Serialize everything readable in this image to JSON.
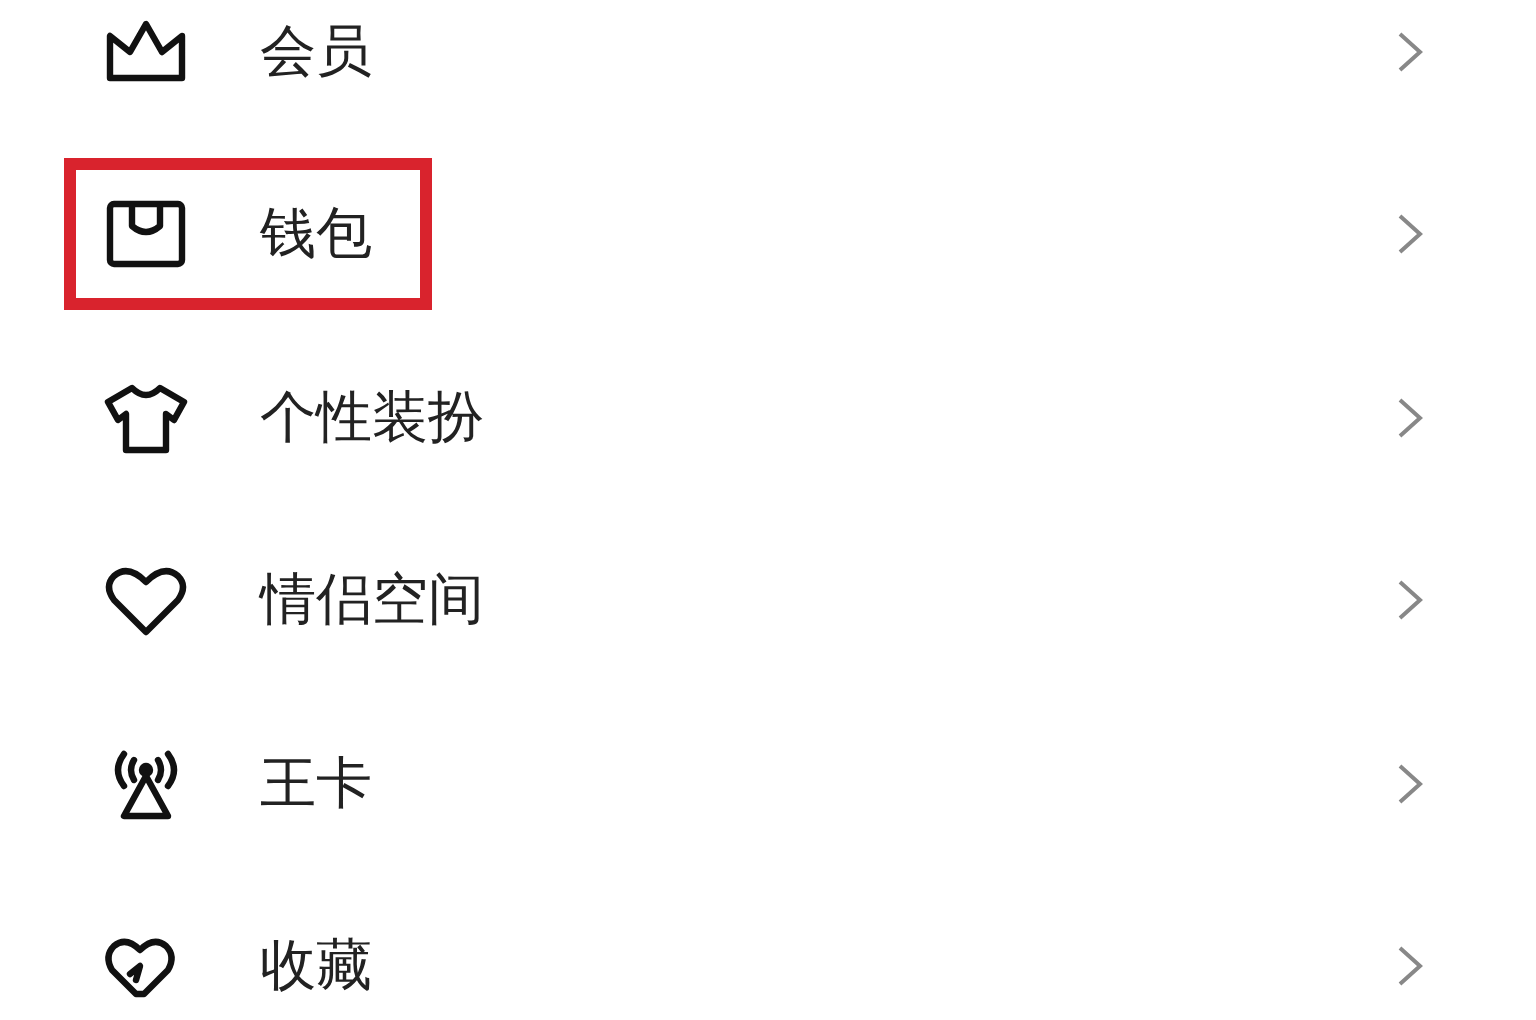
{
  "menu_items": [
    {
      "label": "会员",
      "highlighted": false
    },
    {
      "label": "钱包",
      "highlighted": true
    },
    {
      "label": "个性装扮",
      "highlighted": false
    },
    {
      "label": "情侣空间",
      "highlighted": false
    },
    {
      "label": "王卡",
      "highlighted": false
    },
    {
      "label": "收藏",
      "highlighted": false
    }
  ]
}
